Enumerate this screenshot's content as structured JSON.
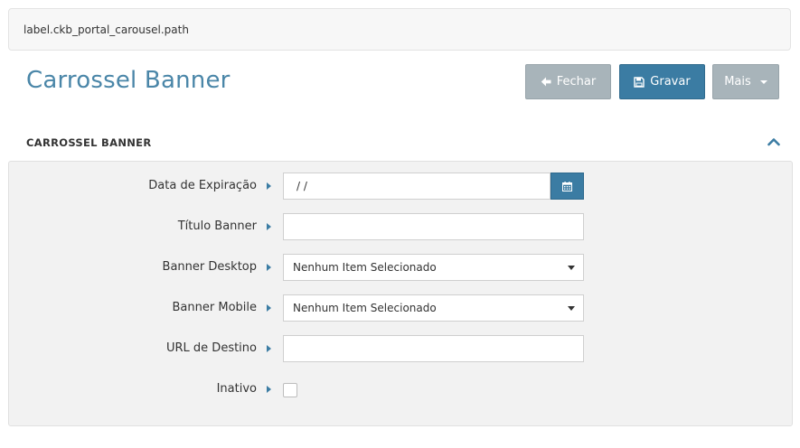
{
  "breadcrumb": {
    "path": "label.ckb_portal_carousel.path"
  },
  "page": {
    "title": "Carrossel Banner"
  },
  "toolbar": {
    "close_label": "Fechar",
    "save_label": "Gravar",
    "more_label": "Mais"
  },
  "section": {
    "title": "CARROSSEL BANNER"
  },
  "form": {
    "expiration": {
      "label": "Data de Expiração",
      "value": "/ /"
    },
    "title": {
      "label": "Título Banner",
      "value": ""
    },
    "desktop": {
      "label": "Banner Desktop",
      "value": "Nenhum Item Selecionado"
    },
    "mobile": {
      "label": "Banner Mobile",
      "value": "Nenhum Item Selecionado"
    },
    "url": {
      "label": "URL de Destino",
      "value": ""
    },
    "inactive": {
      "label": "Inativo",
      "checked": false
    }
  },
  "colors": {
    "accent": "#3b7ca3",
    "title": "#4a86a8",
    "muted_button": "#a8b4ba"
  }
}
